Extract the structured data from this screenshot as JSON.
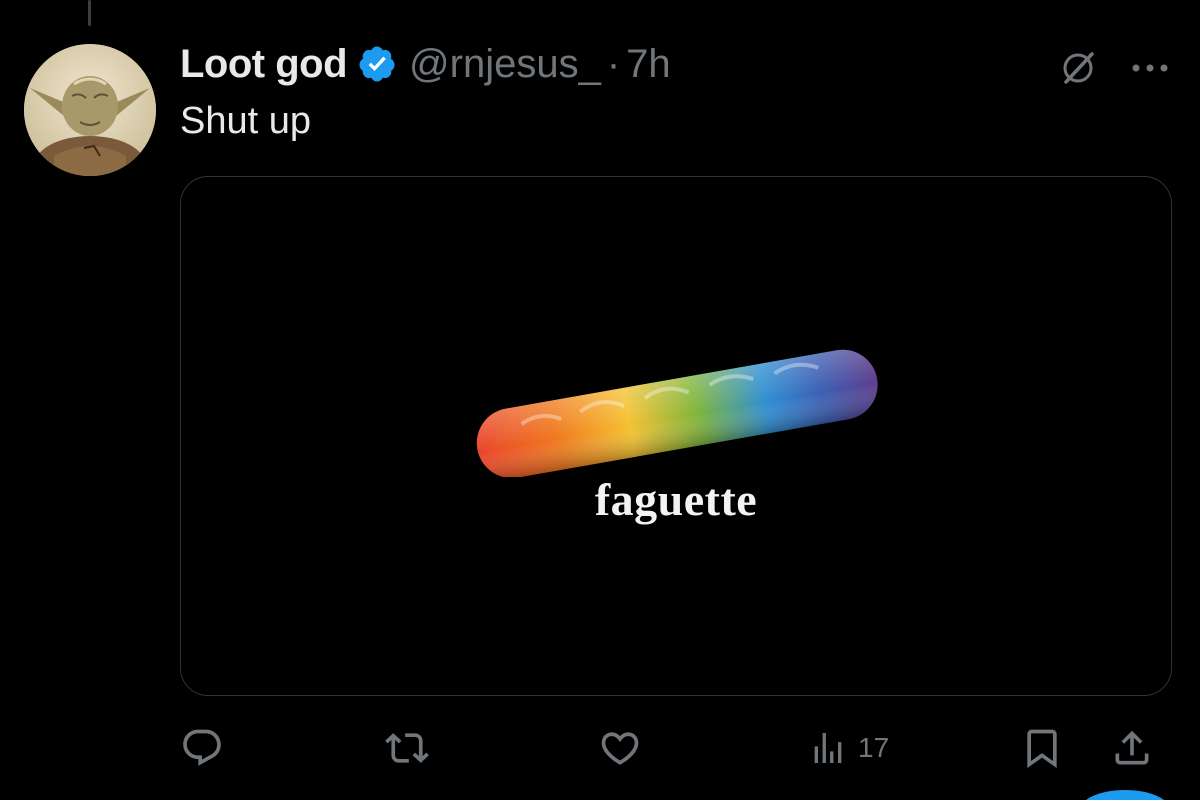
{
  "tweet": {
    "author": {
      "display_name": "Loot god",
      "handle": "@rnjesus_",
      "verified": true,
      "avatar_icon": "yoda-avatar"
    },
    "separator": "·",
    "time": "7h",
    "text": "Shut up",
    "media": {
      "caption": "faguette",
      "image_icon": "rainbow-baguette"
    },
    "actions": {
      "reply_icon": "reply-icon",
      "retweet_icon": "retweet-icon",
      "like_icon": "heart-icon",
      "views_icon": "views-icon",
      "views_count": "17",
      "bookmark_icon": "bookmark-icon",
      "share_icon": "share-icon"
    }
  },
  "colors": {
    "background": "#000000",
    "text_primary": "#e7e9ea",
    "text_secondary": "#71767b",
    "verified_badge": "#1d9bf0",
    "card_border": "#2f3336"
  }
}
